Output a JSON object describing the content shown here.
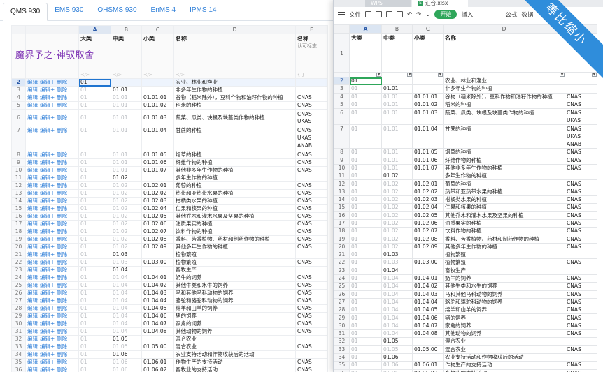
{
  "left": {
    "tabs": [
      "QMS 930",
      "EMS 930",
      "OHSMS 930",
      "EnMS 4",
      "IPMS 14"
    ],
    "active_tab": "QMS 930",
    "watermark": "魔界予之·神驭取舍",
    "col_letters": [
      "A",
      "B",
      "C",
      "D",
      "E"
    ],
    "field_headers": {
      "a": "大类",
      "b": "中类",
      "c": "小类",
      "d": "名称",
      "e": "名称",
      "e_sub": "认可标志"
    },
    "placeholders": {
      "a": "</>",
      "b": "</>",
      "c": "</>",
      "d": "</>",
      "e": "{ }"
    },
    "ops": {
      "edit": "编辑",
      "edit_plus": "编辑+",
      "delete": "删除"
    },
    "rows": [
      {
        "n": "2",
        "a": "01",
        "b": "",
        "c": "",
        "d": "农业、林业和渔业",
        "e": ""
      },
      {
        "n": "3",
        "a": "01",
        "b": "01.01",
        "c": "",
        "d": "非多年生作物的种植",
        "e": ""
      },
      {
        "n": "4",
        "a": "01",
        "b": "01.01",
        "c": "01.01.01",
        "d": "谷物（稻米除外），豆科作物和油籽作物的种植",
        "e": "CNAS"
      },
      {
        "n": "5",
        "a": "01",
        "b": "01.01",
        "c": "01.01.02",
        "d": "稻米的种植",
        "e": "CNAS"
      },
      {
        "n": "6",
        "a": "01",
        "b": "01.01",
        "c": "01.01.03",
        "d": "蔬菜、瓜类、块根及块茎类作物的种植",
        "e": "CNAS\nUKAS"
      },
      {
        "n": "7",
        "a": "01",
        "b": "01.01",
        "c": "01.01.04",
        "d": "甘蔗的种植",
        "e": "CNAS\nUKAS\nANAB"
      },
      {
        "n": "8",
        "a": "01",
        "b": "01.01",
        "c": "01.01.05",
        "d": "烟草的种植",
        "e": "CNAS"
      },
      {
        "n": "9",
        "a": "01",
        "b": "01.01",
        "c": "01.01.06",
        "d": "纤维作物的种植",
        "e": "CNAS"
      },
      {
        "n": "10",
        "a": "01",
        "b": "01.01",
        "c": "01.01.07",
        "d": "其他非多年生作物的种植",
        "e": "CNAS"
      },
      {
        "n": "11",
        "a": "01",
        "b": "01.02",
        "c": "",
        "d": "多年生作物的种植",
        "e": ""
      },
      {
        "n": "12",
        "a": "01",
        "b": "01.02",
        "c": "01.02.01",
        "d": "葡萄的种植",
        "e": "CNAS"
      },
      {
        "n": "13",
        "a": "01",
        "b": "01.02",
        "c": "01.02.02",
        "d": "热带和亚热带水果的种植",
        "e": "CNAS"
      },
      {
        "n": "14",
        "a": "01",
        "b": "01.02",
        "c": "01.02.03",
        "d": "柑橘类水果的种植",
        "e": "CNAS"
      },
      {
        "n": "15",
        "a": "01",
        "b": "01.02",
        "c": "01.02.04",
        "d": "仁果和核果的种植",
        "e": "CNAS"
      },
      {
        "n": "16",
        "a": "01",
        "b": "01.02",
        "c": "01.02.05",
        "d": "其他乔木和灌木水果及坚果的种植",
        "e": "CNAS"
      },
      {
        "n": "17",
        "a": "01",
        "b": "01.02",
        "c": "01.02.06",
        "d": "油质果实的种植",
        "e": "CNAS"
      },
      {
        "n": "18",
        "a": "01",
        "b": "01.02",
        "c": "01.02.07",
        "d": "饮料作物的种植",
        "e": "CNAS"
      },
      {
        "n": "19",
        "a": "01",
        "b": "01.02",
        "c": "01.02.08",
        "d": "香料、芳香植物、药材和制药作物的种植",
        "e": "CNAS"
      },
      {
        "n": "20",
        "a": "01",
        "b": "01.02",
        "c": "01.02.09",
        "d": "其他多年生作物的种植",
        "e": "CNAS"
      },
      {
        "n": "21",
        "a": "01",
        "b": "01.03",
        "c": "",
        "d": "植物繁殖",
        "e": ""
      },
      {
        "n": "22",
        "a": "01",
        "b": "01.03",
        "c": "01.03.00",
        "d": "植物繁殖",
        "e": "CNAS"
      },
      {
        "n": "23",
        "a": "01",
        "b": "01.04",
        "c": "",
        "d": "畜牧生产",
        "e": ""
      },
      {
        "n": "24",
        "a": "01",
        "b": "01.04",
        "c": "01.04.01",
        "d": "奶牛的饲养",
        "e": "CNAS"
      },
      {
        "n": "25",
        "a": "01",
        "b": "01.04",
        "c": "01.04.02",
        "d": "其他牛类和水牛的饲养",
        "e": "CNAS"
      },
      {
        "n": "26",
        "a": "01",
        "b": "01.04",
        "c": "01.04.03",
        "d": "马和其他马科动物的饲养",
        "e": "CNAS"
      },
      {
        "n": "27",
        "a": "01",
        "b": "01.04",
        "c": "01.04.04",
        "d": "骆驼和骆驼科动物的饲养",
        "e": "CNAS"
      },
      {
        "n": "28",
        "a": "01",
        "b": "01.04",
        "c": "01.04.05",
        "d": "绵羊和山羊的饲养",
        "e": "CNAS"
      },
      {
        "n": "29",
        "a": "01",
        "b": "01.04",
        "c": "01.04.06",
        "d": "猪的饲养",
        "e": "CNAS"
      },
      {
        "n": "30",
        "a": "01",
        "b": "01.04",
        "c": "01.04.07",
        "d": "家禽的饲养",
        "e": "CNAS"
      },
      {
        "n": "31",
        "a": "01",
        "b": "01.04",
        "c": "01.04.08",
        "d": "其他动物的饲养",
        "e": "CNAS"
      },
      {
        "n": "32",
        "a": "01",
        "b": "01.05",
        "c": "",
        "d": "混合农业",
        "e": ""
      },
      {
        "n": "33",
        "a": "01",
        "b": "01.05",
        "c": "01.05.00",
        "d": "混合农业",
        "e": "CNAS"
      },
      {
        "n": "34",
        "a": "01",
        "b": "01.06",
        "c": "",
        "d": "农业支持活动和作物收获后的活动",
        "e": ""
      },
      {
        "n": "35",
        "a": "01",
        "b": "01.06",
        "c": "01.06.01",
        "d": "作物生产的支持活动",
        "e": "CNAS"
      },
      {
        "n": "36",
        "a": "01",
        "b": "01.06",
        "c": "01.06.02",
        "d": "畜牧业的支持活动",
        "e": "CNAS"
      }
    ]
  },
  "right": {
    "app_tab": "WPS",
    "file_tab": "汇合.xlsx",
    "toolbar": {
      "file": "文件",
      "start": "开始",
      "insert": "插入",
      "formula": "公式",
      "data": "数据"
    },
    "col_letters": [
      "A",
      "B",
      "C",
      "D",
      "E"
    ],
    "headers": {
      "a": "大类",
      "b": "中类",
      "c": "小类",
      "d": "名称",
      "e": "名称"
    },
    "banner": "等比缩小",
    "rows": [
      {
        "n": "2",
        "a": "01",
        "b": "",
        "c": "",
        "d": "农业、林业和渔业",
        "e": ""
      },
      {
        "n": "3",
        "a": "01",
        "b": "01.01",
        "c": "",
        "d": "非多年生作物的种植",
        "e": ""
      },
      {
        "n": "4",
        "a": "01",
        "b": "01.01",
        "c": "01.01.01",
        "d": "谷物（稻米除外），豆科作物和油籽作物的种植",
        "e": "CNAS"
      },
      {
        "n": "5",
        "a": "01",
        "b": "01.01",
        "c": "01.01.02",
        "d": "稻米的种植",
        "e": "CNAS"
      },
      {
        "n": "6",
        "a": "01",
        "b": "01.01",
        "c": "01.01.03",
        "d": "蔬菜、瓜类、块根及块茎类作物的种植",
        "e": "CNAS\nUKAS"
      },
      {
        "n": "7",
        "a": "01",
        "b": "01.01",
        "c": "01.01.04",
        "d": "甘蔗的种植",
        "e": "CNAS\nUKAS\nANAB"
      },
      {
        "n": "8",
        "a": "01",
        "b": "01.01",
        "c": "01.01.05",
        "d": "烟草的种植",
        "e": "CNAS"
      },
      {
        "n": "9",
        "a": "01",
        "b": "01.01",
        "c": "01.01.06",
        "d": "纤维作物的种植",
        "e": "CNAS"
      },
      {
        "n": "10",
        "a": "01",
        "b": "01.01",
        "c": "01.01.07",
        "d": "其他非多年生作物的种植",
        "e": "CNAS"
      },
      {
        "n": "11",
        "a": "01",
        "b": "01.02",
        "c": "",
        "d": "多年生作物的种植",
        "e": ""
      },
      {
        "n": "12",
        "a": "01",
        "b": "01.02",
        "c": "01.02.01",
        "d": "葡萄的种植",
        "e": "CNAS"
      },
      {
        "n": "13",
        "a": "01",
        "b": "01.02",
        "c": "01.02.02",
        "d": "热带和亚热带水果的种植",
        "e": "CNAS"
      },
      {
        "n": "14",
        "a": "01",
        "b": "01.02",
        "c": "01.02.03",
        "d": "柑橘类水果的种植",
        "e": "CNAS"
      },
      {
        "n": "15",
        "a": "01",
        "b": "01.02",
        "c": "01.02.04",
        "d": "仁果和核果的种植",
        "e": "CNAS"
      },
      {
        "n": "16",
        "a": "01",
        "b": "01.02",
        "c": "01.02.05",
        "d": "其他乔木和灌木水果及坚果的种植",
        "e": "CNAS"
      },
      {
        "n": "17",
        "a": "01",
        "b": "01.02",
        "c": "01.02.06",
        "d": "油质果实的种植",
        "e": "CNAS"
      },
      {
        "n": "18",
        "a": "01",
        "b": "01.02",
        "c": "01.02.07",
        "d": "饮料作物的种植",
        "e": "CNAS"
      },
      {
        "n": "19",
        "a": "01",
        "b": "01.02",
        "c": "01.02.08",
        "d": "香料、芳香植物、药材和制药作物的种植",
        "e": "CNAS"
      },
      {
        "n": "20",
        "a": "01",
        "b": "01.02",
        "c": "01.02.09",
        "d": "其他多年生作物的种植",
        "e": "CNAS"
      },
      {
        "n": "21",
        "a": "01",
        "b": "01.03",
        "c": "",
        "d": "植物繁殖",
        "e": ""
      },
      {
        "n": "22",
        "a": "01",
        "b": "01.03",
        "c": "01.03.00",
        "d": "植物繁殖",
        "e": "CNAS"
      },
      {
        "n": "23",
        "a": "01",
        "b": "01.04",
        "c": "",
        "d": "畜牧生产",
        "e": ""
      },
      {
        "n": "24",
        "a": "01",
        "b": "01.04",
        "c": "01.04.01",
        "d": "奶牛的饲养",
        "e": "CNAS"
      },
      {
        "n": "25",
        "a": "01",
        "b": "01.04",
        "c": "01.04.02",
        "d": "其他牛类和水牛的饲养",
        "e": "CNAS"
      },
      {
        "n": "26",
        "a": "01",
        "b": "01.04",
        "c": "01.04.03",
        "d": "马和其他马科动物的饲养",
        "e": "CNAS"
      },
      {
        "n": "27",
        "a": "01",
        "b": "01.04",
        "c": "01.04.04",
        "d": "骆驼和骆驼科动物的饲养",
        "e": "CNAS"
      },
      {
        "n": "28",
        "a": "01",
        "b": "01.04",
        "c": "01.04.05",
        "d": "绵羊和山羊的饲养",
        "e": "CNAS"
      },
      {
        "n": "29",
        "a": "01",
        "b": "01.04",
        "c": "01.04.06",
        "d": "猪的饲养",
        "e": "CNAS"
      },
      {
        "n": "30",
        "a": "01",
        "b": "01.04",
        "c": "01.04.07",
        "d": "家禽的饲养",
        "e": "CNAS"
      },
      {
        "n": "31",
        "a": "01",
        "b": "01.04",
        "c": "01.04.08",
        "d": "其他动物的饲养",
        "e": "CNAS"
      },
      {
        "n": "32",
        "a": "01",
        "b": "01.05",
        "c": "",
        "d": "混合农业",
        "e": ""
      },
      {
        "n": "33",
        "a": "01",
        "b": "01.05",
        "c": "01.05.00",
        "d": "混合农业",
        "e": "CNAS"
      },
      {
        "n": "34",
        "a": "01",
        "b": "01.06",
        "c": "",
        "d": "农业支持活动和作物收获后的活动",
        "e": ""
      },
      {
        "n": "35",
        "a": "01",
        "b": "01.06",
        "c": "01.06.01",
        "d": "作物生产的支持活动",
        "e": "CNAS"
      },
      {
        "n": "36",
        "a": "01",
        "b": "01.06",
        "c": "01.06.02",
        "d": "畜牧业的支持活动",
        "e": "CNAS"
      }
    ]
  }
}
